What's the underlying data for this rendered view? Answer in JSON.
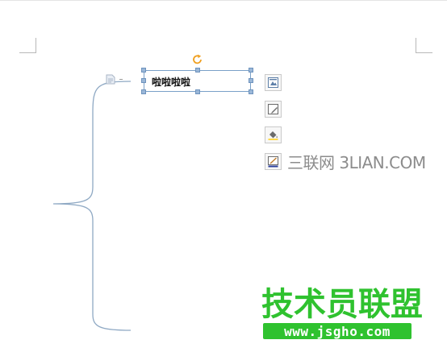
{
  "textbox": {
    "text": "啦啦啦啦"
  },
  "icons": {
    "anchor": "anchor-icon",
    "rotate": "rotate-icon",
    "layout_options": "layout-options-icon",
    "shape_style": "shape-style-icon",
    "shape_fill": "shape-fill-icon",
    "shape_outline": "shape-outline-icon"
  },
  "watermarks": {
    "sanlian": "三联网 3LIAN.COM",
    "jsy_title": "技术员联盟",
    "jsy_url": "www.jsgho.com"
  },
  "colors": {
    "selection_border": "#7aa0c8",
    "handle_fill": "#9ab7d8",
    "rotate_handle": "#f0a020",
    "brace_line": "#8fa9c4",
    "watermark_green": "#2fc22f",
    "watermark_gray": "#8c8c8c"
  }
}
